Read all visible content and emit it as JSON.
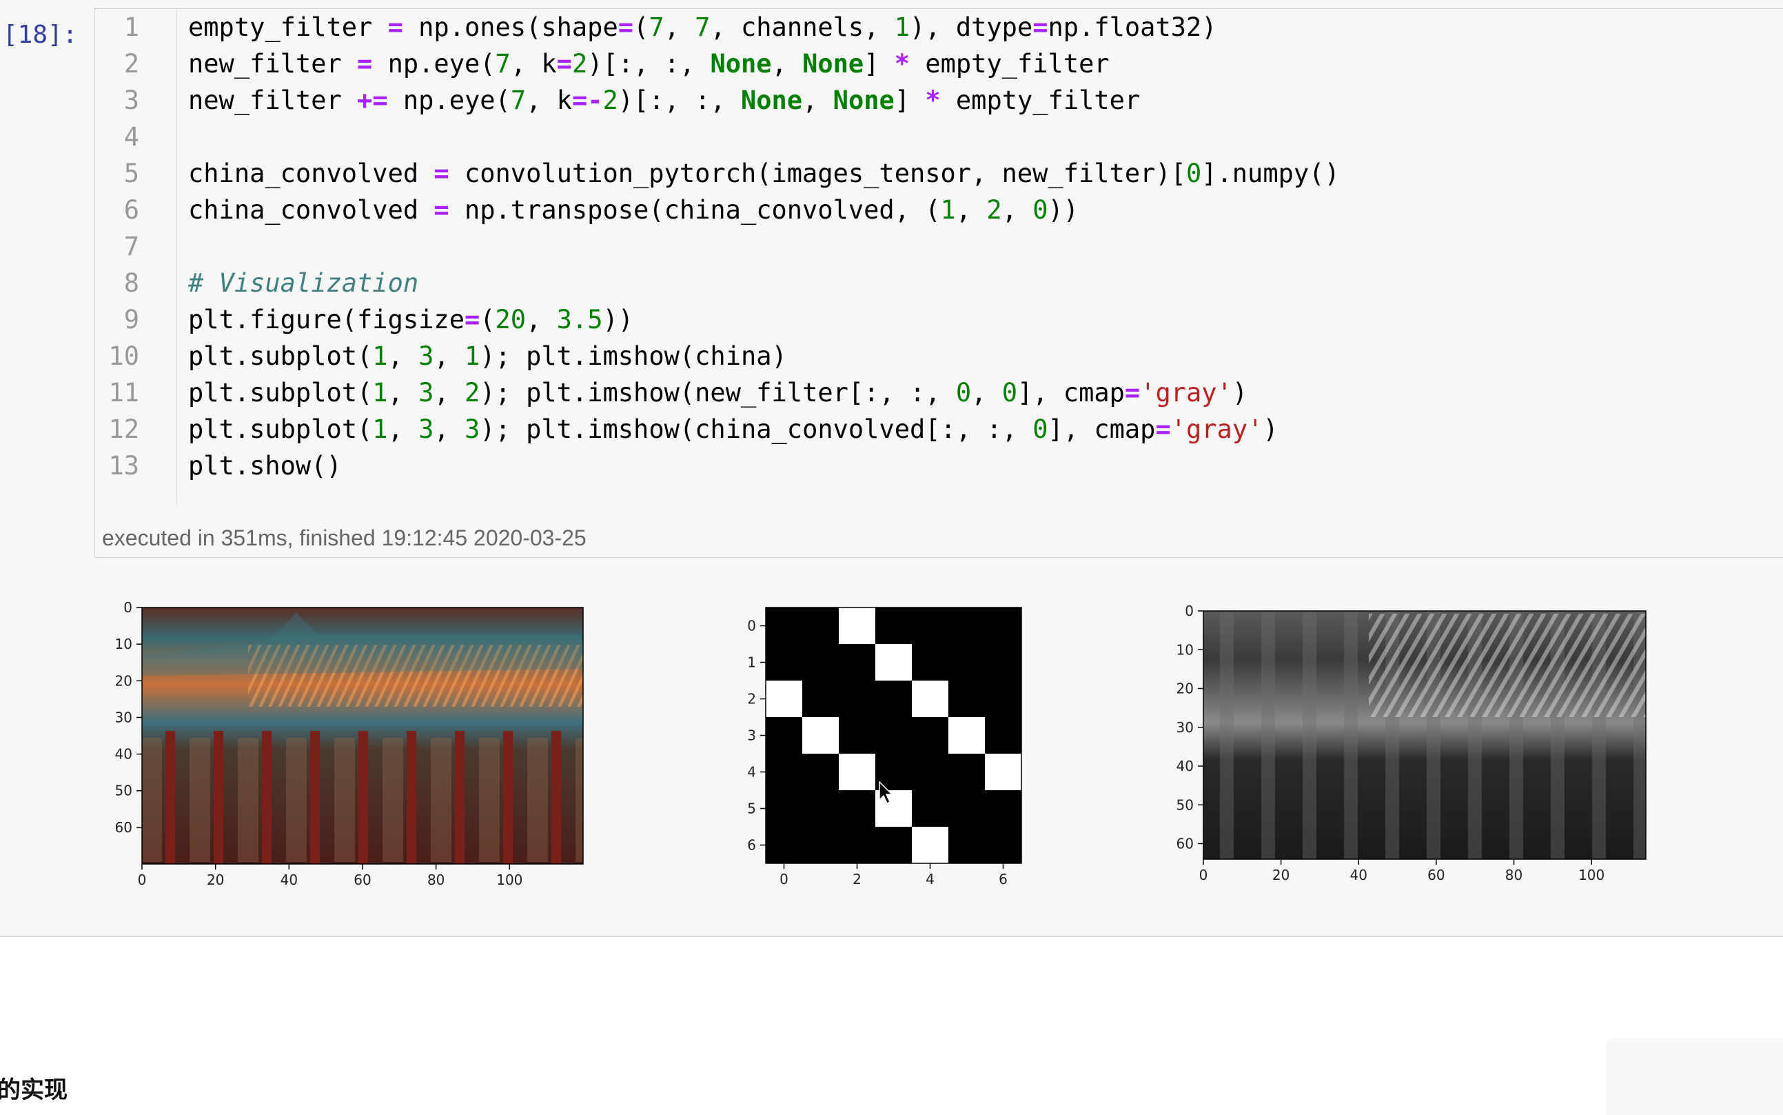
{
  "cell": {
    "prompt": "[18]:",
    "line_numbers": [
      "1",
      "2",
      "3",
      "4",
      "5",
      "6",
      "7",
      "8",
      "9",
      "10",
      "11",
      "12",
      "13"
    ],
    "code_lines": [
      [
        [
          "empty_filter ",
          ""
        ],
        [
          "=",
          "o"
        ],
        [
          " np.ones(shape",
          ""
        ],
        [
          "=",
          "o"
        ],
        [
          "(",
          ""
        ],
        [
          "7",
          "n"
        ],
        [
          ", ",
          ""
        ],
        [
          "7",
          "n"
        ],
        [
          ", channels, ",
          ""
        ],
        [
          "1",
          "n"
        ],
        [
          "), dtype",
          ""
        ],
        [
          "=",
          "o"
        ],
        [
          "np.float32)",
          ""
        ]
      ],
      [
        [
          "new_filter ",
          ""
        ],
        [
          "=",
          "o"
        ],
        [
          " np.eye(",
          ""
        ],
        [
          "7",
          "n"
        ],
        [
          ", k",
          ""
        ],
        [
          "=",
          "o"
        ],
        [
          "2",
          "n"
        ],
        [
          ")[:, :, ",
          ""
        ],
        [
          "None",
          "k"
        ],
        [
          ", ",
          ""
        ],
        [
          "None",
          "k"
        ],
        [
          "] ",
          ""
        ],
        [
          "*",
          "o"
        ],
        [
          " empty_filter",
          ""
        ]
      ],
      [
        [
          "new_filter ",
          ""
        ],
        [
          "+=",
          "o"
        ],
        [
          " np.eye(",
          ""
        ],
        [
          "7",
          "n"
        ],
        [
          ", k",
          ""
        ],
        [
          "=-",
          "o"
        ],
        [
          "2",
          "n"
        ],
        [
          ")[:, :, ",
          ""
        ],
        [
          "None",
          "k"
        ],
        [
          ", ",
          ""
        ],
        [
          "None",
          "k"
        ],
        [
          "] ",
          ""
        ],
        [
          "*",
          "o"
        ],
        [
          " empty_filter",
          ""
        ]
      ],
      [],
      [
        [
          "china_convolved ",
          ""
        ],
        [
          "=",
          "o"
        ],
        [
          " convolution_pytorch(images_tensor, new_filter)[",
          ""
        ],
        [
          "0",
          "n"
        ],
        [
          "].numpy()",
          ""
        ]
      ],
      [
        [
          "china_convolved ",
          ""
        ],
        [
          "=",
          "o"
        ],
        [
          " np.transpose(china_convolved, (",
          ""
        ],
        [
          "1",
          "n"
        ],
        [
          ", ",
          ""
        ],
        [
          "2",
          "n"
        ],
        [
          ", ",
          ""
        ],
        [
          "0",
          "n"
        ],
        [
          "))",
          ""
        ]
      ],
      [],
      [
        [
          "# Visualization",
          "c"
        ]
      ],
      [
        [
          "plt.figure(figsize",
          ""
        ],
        [
          "=",
          "o"
        ],
        [
          "(",
          ""
        ],
        [
          "20",
          "n"
        ],
        [
          ", ",
          ""
        ],
        [
          "3.5",
          "n"
        ],
        [
          "))",
          ""
        ]
      ],
      [
        [
          "plt.subplot(",
          ""
        ],
        [
          "1",
          "n"
        ],
        [
          ", ",
          ""
        ],
        [
          "3",
          "n"
        ],
        [
          ", ",
          ""
        ],
        [
          "1",
          "n"
        ],
        [
          "); plt.imshow(china)",
          ""
        ]
      ],
      [
        [
          "plt.subplot(",
          ""
        ],
        [
          "1",
          "n"
        ],
        [
          ", ",
          ""
        ],
        [
          "3",
          "n"
        ],
        [
          ", ",
          ""
        ],
        [
          "2",
          "n"
        ],
        [
          "); plt.imshow(new_filter[:, :, ",
          ""
        ],
        [
          "0",
          "n"
        ],
        [
          ", ",
          ""
        ],
        [
          "0",
          "n"
        ],
        [
          "], cmap",
          ""
        ],
        [
          "=",
          "o"
        ],
        [
          "'gray'",
          "s"
        ],
        [
          ")",
          ""
        ]
      ],
      [
        [
          "plt.subplot(",
          ""
        ],
        [
          "1",
          "n"
        ],
        [
          ", ",
          ""
        ],
        [
          "3",
          "n"
        ],
        [
          ", ",
          ""
        ],
        [
          "3",
          "n"
        ],
        [
          "); plt.imshow(china_convolved[:, :, ",
          ""
        ],
        [
          "0",
          "n"
        ],
        [
          "], cmap",
          ""
        ],
        [
          "=",
          "o"
        ],
        [
          "'gray'",
          "s"
        ],
        [
          ")",
          ""
        ]
      ],
      [
        [
          "plt.show()",
          ""
        ]
      ]
    ],
    "execution_info": "executed in 351ms, finished 19:12:45 2020-03-25"
  },
  "plots": {
    "left": {
      "x_ticks": [
        "0",
        "20",
        "40",
        "60",
        "80",
        "100"
      ],
      "y_ticks": [
        "0",
        "10",
        "20",
        "30",
        "40",
        "50",
        "60"
      ],
      "xlim": [
        0,
        120
      ],
      "ylim": [
        0,
        70
      ]
    },
    "middle": {
      "x_ticks": [
        "0",
        "2",
        "4",
        "6"
      ],
      "y_ticks": [
        "0",
        "1",
        "2",
        "3",
        "4",
        "5",
        "6"
      ],
      "white_cells": [
        [
          0,
          2
        ],
        [
          1,
          3
        ],
        [
          2,
          0
        ],
        [
          2,
          4
        ],
        [
          3,
          1
        ],
        [
          3,
          5
        ],
        [
          4,
          2
        ],
        [
          4,
          6
        ],
        [
          5,
          3
        ],
        [
          6,
          4
        ]
      ]
    },
    "right": {
      "x_ticks": [
        "0",
        "20",
        "40",
        "60",
        "80",
        "100"
      ],
      "y_ticks": [
        "0",
        "10",
        "20",
        "30",
        "40",
        "50",
        "60"
      ],
      "xlim": [
        0,
        114
      ],
      "ylim": [
        0,
        64
      ]
    }
  },
  "bottom_heading": "的实现",
  "colors": {
    "prompt": "#303f9f",
    "keyword": "#008000",
    "operator": "#aa22ff",
    "string": "#ba2121",
    "comment": "#408080"
  }
}
